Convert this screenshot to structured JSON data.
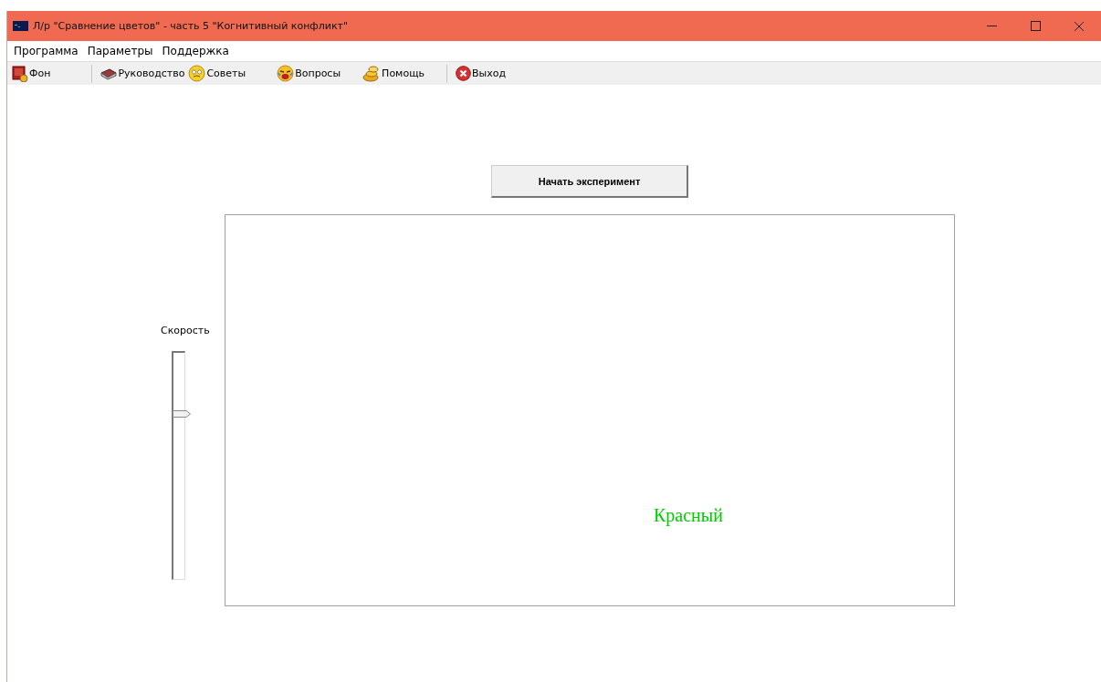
{
  "window": {
    "title": "Л/р \"Сравнение цветов\" - часть 5 \"Когнитивный конфликт\""
  },
  "menu": [
    "Программа",
    "Параметры",
    "Поддержка"
  ],
  "toolbar": [
    {
      "kind": "background",
      "label": "Фон"
    },
    {
      "kind": "separator"
    },
    {
      "kind": "guide",
      "label": "Руководство"
    },
    {
      "kind": "tips",
      "label": "Советы"
    },
    {
      "kind": "questions",
      "label": "Вопросы"
    },
    {
      "kind": "help",
      "label": "Помощь"
    },
    {
      "kind": "separator"
    },
    {
      "kind": "exit",
      "label": "Выход"
    }
  ],
  "start_button": "Начать эксперимент",
  "speed": {
    "label": "Скорость"
  },
  "stimulus": {
    "word": "Красный",
    "color": "#00cc00"
  }
}
